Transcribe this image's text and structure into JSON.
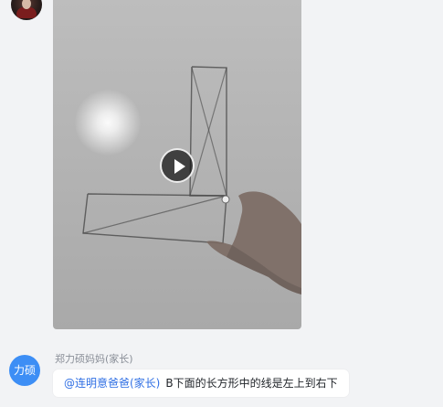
{
  "chat": {
    "top_avatar": {
      "icon": "user-avatar"
    },
    "video": {
      "play_icon": "play-icon"
    },
    "message": {
      "avatar_text": "力硕",
      "sender_name": "郑力硕妈妈(家长)",
      "mention": "@连明意爸爸(家长)",
      "text": "B下面的长方形中的线是左上到右下"
    }
  },
  "colors": {
    "background": "#f2f3f5",
    "avatar_blue": "#3d8ef5",
    "mention_blue": "#2f6fe4"
  }
}
